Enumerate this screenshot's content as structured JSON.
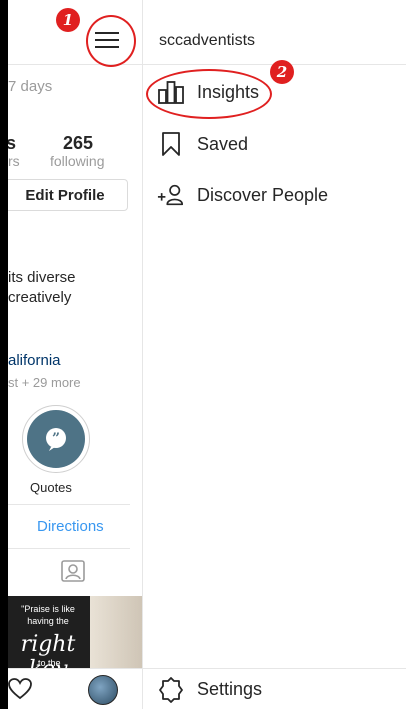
{
  "profile_peek": {
    "post_age": "7 days",
    "followers_suffix": "rs",
    "following_count": "265",
    "following_label": "following",
    "edit_profile_label": "Edit Profile",
    "bio_line1": "its diverse",
    "bio_line2": "creatively",
    "location": "alifornia",
    "location_more": "st + 29 more",
    "highlight_label": "Quotes",
    "directions_label": "Directions",
    "photo_quote_line1": "\"Praise is like",
    "photo_quote_line2": "having the",
    "photo_quote_script": "right key",
    "photo_quote_line3": "to the"
  },
  "menu": {
    "username": "sccadventists",
    "items": [
      {
        "label": "Insights",
        "icon": "bar-chart-icon"
      },
      {
        "label": "Saved",
        "icon": "bookmark-icon"
      },
      {
        "label": "Discover People",
        "icon": "add-person-icon"
      }
    ],
    "settings_label": "Settings"
  },
  "annotations": {
    "badge1": "1",
    "badge2": "2",
    "color": "#e02020"
  }
}
